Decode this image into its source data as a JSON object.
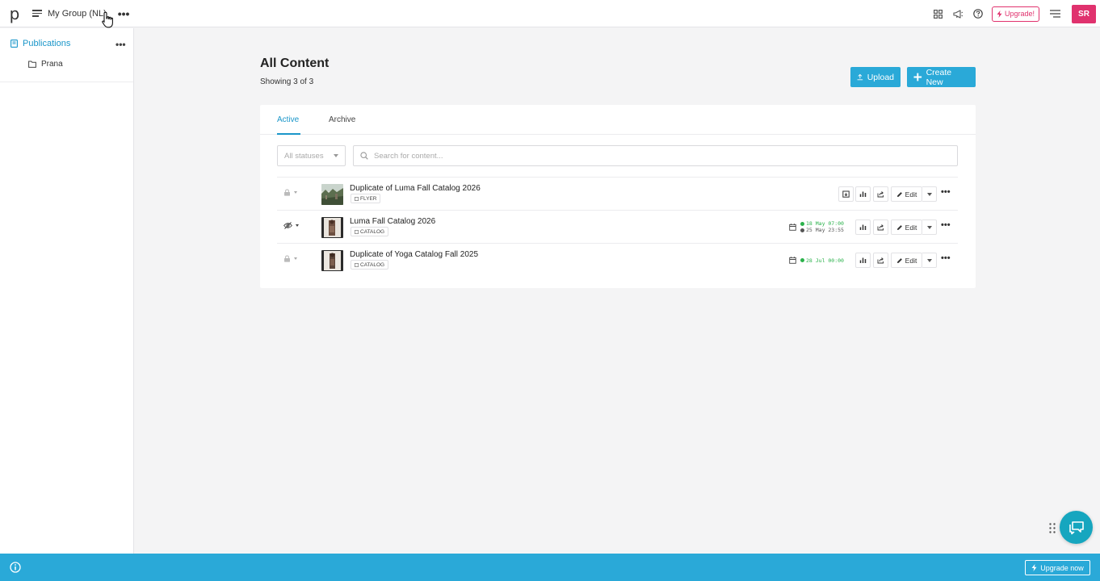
{
  "header": {
    "logo": "p",
    "group_name": "My Group (NL)",
    "more": "•••",
    "upgrade_label": "Upgrade!",
    "avatar_initials": "SR"
  },
  "sidebar": {
    "publications_label": "Publications",
    "more": "•••",
    "folder_label": "Prana"
  },
  "main": {
    "title": "All Content",
    "subtitle": "Showing 3 of 3",
    "upload_label": "Upload",
    "create_label": "Create New",
    "tabs": [
      {
        "label": "Active",
        "active": true
      },
      {
        "label": "Archive",
        "active": false
      }
    ],
    "status_filter": "All statuses",
    "search_placeholder": "Search for content..."
  },
  "rows": [
    {
      "title": "Duplicate of Luma Fall Catalog 2026",
      "tag": "FLYER",
      "visibility_icon": "lock-icon",
      "schedule": null
    },
    {
      "title": "Luma Fall Catalog 2026",
      "tag": "CATALOG",
      "visibility_icon": "eye-off-icon",
      "schedule": {
        "start": "18 May 07:00",
        "end": "25 May 23:55"
      }
    },
    {
      "title": "Duplicate of Yoga Catalog Fall 2025",
      "tag": "CATALOG",
      "visibility_icon": "lock-icon",
      "schedule": {
        "start": "28 Jul 00:00"
      }
    }
  ],
  "row_actions": {
    "edit_label": "Edit",
    "more": "•••"
  },
  "footer": {
    "upgrade_now_label": "Upgrade now"
  },
  "colors": {
    "accent": "#2aa9d8",
    "link": "#1a96c9",
    "brand_pink": "#e0326e",
    "chat": "#16a6bf",
    "schedule_green": "#2bb24c",
    "schedule_grey": "#555555"
  }
}
